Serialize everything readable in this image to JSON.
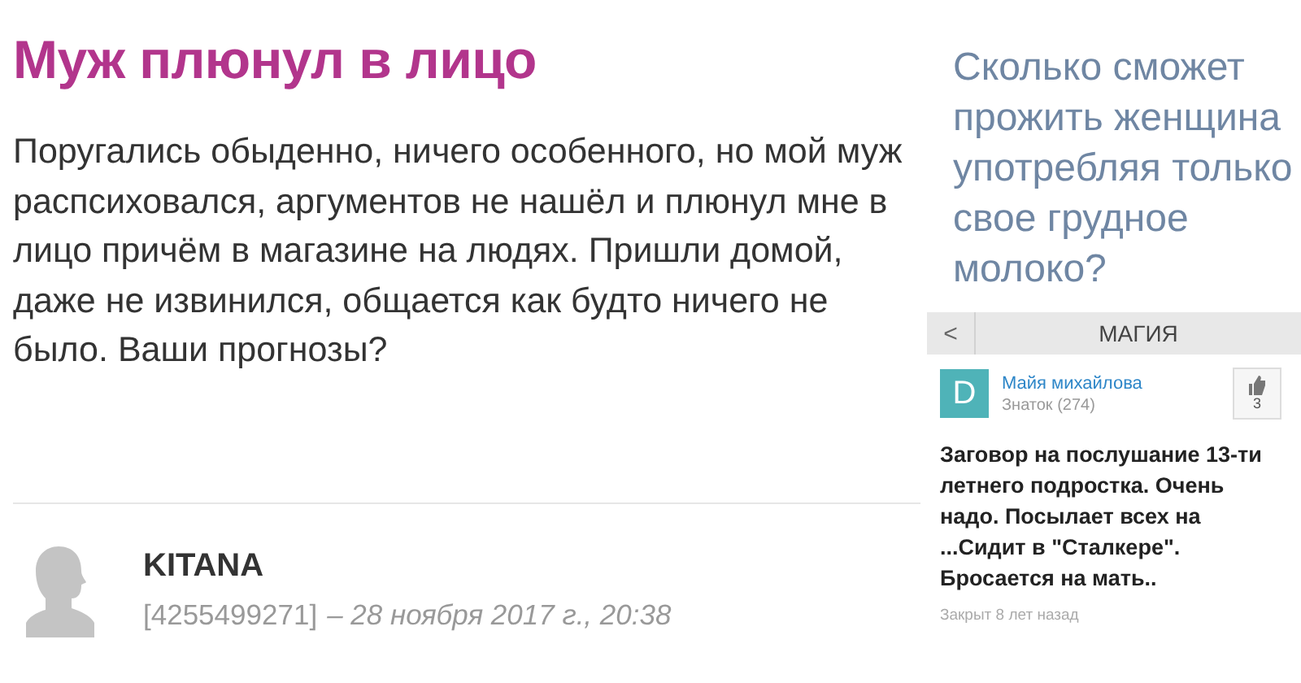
{
  "post": {
    "title": "Муж плюнул в лицо",
    "body": "Поругались обыденно, ничего особенного, но мой муж распсиховался, аргументов не нашёл и плюнул мне в лицо причём в магазине на людях. Пришли домой, даже не извинился, общается как будто ничего не было. Ваши прогнозы?"
  },
  "comment": {
    "author": "KITANA",
    "id": "[4255499271]",
    "date": "– 28 ноября 2017 г., 20:38"
  },
  "question": {
    "text": "Сколько сможет прожить женщина употребляя только свое грудное молоко?"
  },
  "category": {
    "back": "<",
    "title": "МАГИЯ"
  },
  "answer": {
    "avatar_letter": "D",
    "author": "Майя михайлова",
    "rank": "Знаток (274)",
    "likes": "3",
    "text": "Заговор на послушание 13-ти летнего подростка. Очень надо. Посылает всех на ...Сидит в \"Сталкере\". Бросается на мать..",
    "status": "Закрыт 8 лет назад"
  }
}
